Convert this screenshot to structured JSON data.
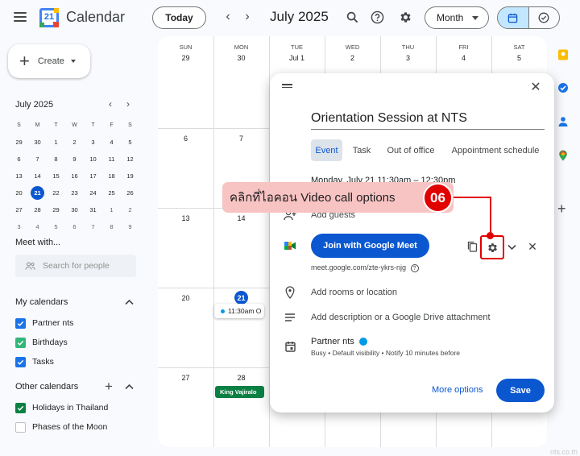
{
  "header": {
    "app_title": "Calendar",
    "logo_number": "21",
    "today_label": "Today",
    "month_label": "July 2025",
    "view_label": "Month"
  },
  "sidebar": {
    "create_label": "Create",
    "mini_month_title": "July 2025",
    "mini_weekdays": [
      "S",
      "M",
      "T",
      "W",
      "T",
      "F",
      "S"
    ],
    "mini_weeks": [
      [
        "29",
        "30",
        "1",
        "2",
        "3",
        "4",
        "5"
      ],
      [
        "6",
        "7",
        "8",
        "9",
        "10",
        "11",
        "12"
      ],
      [
        "13",
        "14",
        "15",
        "16",
        "17",
        "18",
        "19"
      ],
      [
        "20",
        "21",
        "22",
        "23",
        "24",
        "25",
        "26"
      ],
      [
        "27",
        "28",
        "29",
        "30",
        "31",
        "1",
        "2"
      ],
      [
        "3",
        "4",
        "5",
        "6",
        "7",
        "8",
        "9"
      ]
    ],
    "meet_with_label": "Meet with...",
    "search_people_placeholder": "Search for people",
    "my_calendars_title": "My calendars",
    "my_calendars": [
      {
        "label": "Partner nts",
        "color": "#1a73e8",
        "checked": true
      },
      {
        "label": "Birthdays",
        "color": "#33b679",
        "checked": true
      },
      {
        "label": "Tasks",
        "color": "#1a73e8",
        "checked": true
      }
    ],
    "other_calendars_title": "Other calendars",
    "other_calendars": [
      {
        "label": "Holidays in Thailand",
        "color": "#0b8043",
        "checked": true
      },
      {
        "label": "Phases of the Moon",
        "color": "#bdc1c6",
        "checked": false
      }
    ]
  },
  "grid": {
    "weekdays": [
      "SUN",
      "MON",
      "TUE",
      "WED",
      "THU",
      "FRI",
      "SAT"
    ],
    "weeks": [
      [
        "29",
        "30",
        "Jul 1",
        "2",
        "3",
        "4",
        "5"
      ],
      [
        "6",
        "7",
        "",
        "",
        "",
        "",
        ""
      ],
      [
        "13",
        "14",
        "",
        "",
        "",
        "",
        ""
      ],
      [
        "20",
        "21",
        "",
        "",
        "",
        "",
        ""
      ],
      [
        "27",
        "28",
        "",
        "",
        "",
        "",
        ""
      ]
    ],
    "today_day": "21",
    "event_chip": "11:30am O",
    "holiday_chip": "King Vajiralo"
  },
  "dialog": {
    "title_value": "Orientation Session at NTS",
    "tabs": [
      "Event",
      "Task",
      "Out of office",
      "Appointment schedule"
    ],
    "date_text": "Monday, July 21    11:30am – 12:30pm",
    "add_guests": "Add guests",
    "meet_button": "Join with Google Meet",
    "meet_link": "meet.google.com/zte-ykrs-njg",
    "add_location": "Add rooms or location",
    "add_description": "Add description or a Google Drive attachment",
    "calendar_name": "Partner nts",
    "calendar_details": "Busy • Default visibility • Notify 10 minutes before",
    "more_options": "More options",
    "save": "Save"
  },
  "annotation": {
    "text": "คลิกที่ไอคอน Video call options",
    "step": "06"
  },
  "watermark": "nts.co.th",
  "colors": {
    "accent": "#0b57d0",
    "highlight": "#e10000",
    "callout_bg": "#f8c3c3"
  }
}
